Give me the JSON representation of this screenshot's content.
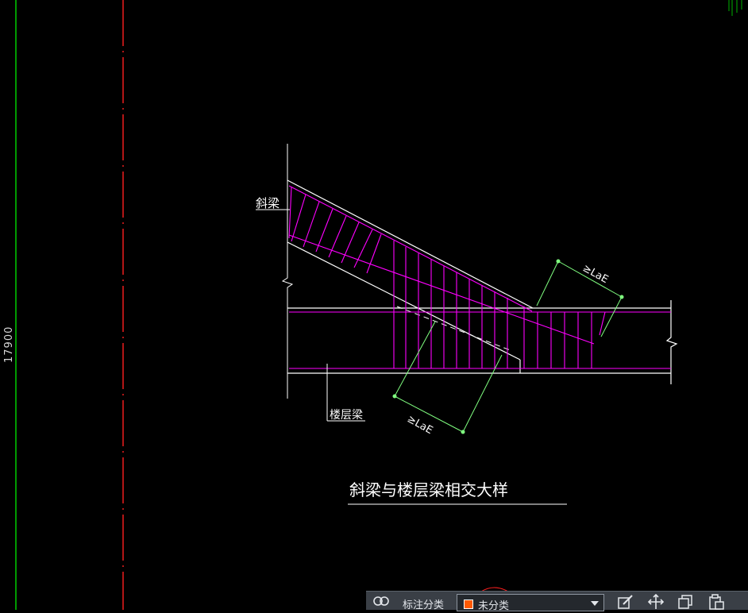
{
  "drawing": {
    "dimension_vertical": "17900",
    "label_inclined_beam": "斜梁",
    "label_floor_beam": "楼层梁",
    "anchorage_upper": "≥LaE",
    "anchorage_lower": "≥LaE",
    "detail_title": "斜梁与楼层梁相交大样"
  },
  "colors": {
    "background": "#000000",
    "beam_outline": "#ffffff",
    "rebar": "#ff00ff",
    "dimension": "#80ff80",
    "axis_green": "#00cc00",
    "axis_red": "#ff2020"
  },
  "toolbar": {
    "category_label": "标注分类",
    "category_value": "未分类",
    "category_color": "#ff5a00",
    "icons": [
      "annotation-icon",
      "edit-icon",
      "move-icon",
      "copy-icon",
      "paste-icon"
    ]
  }
}
